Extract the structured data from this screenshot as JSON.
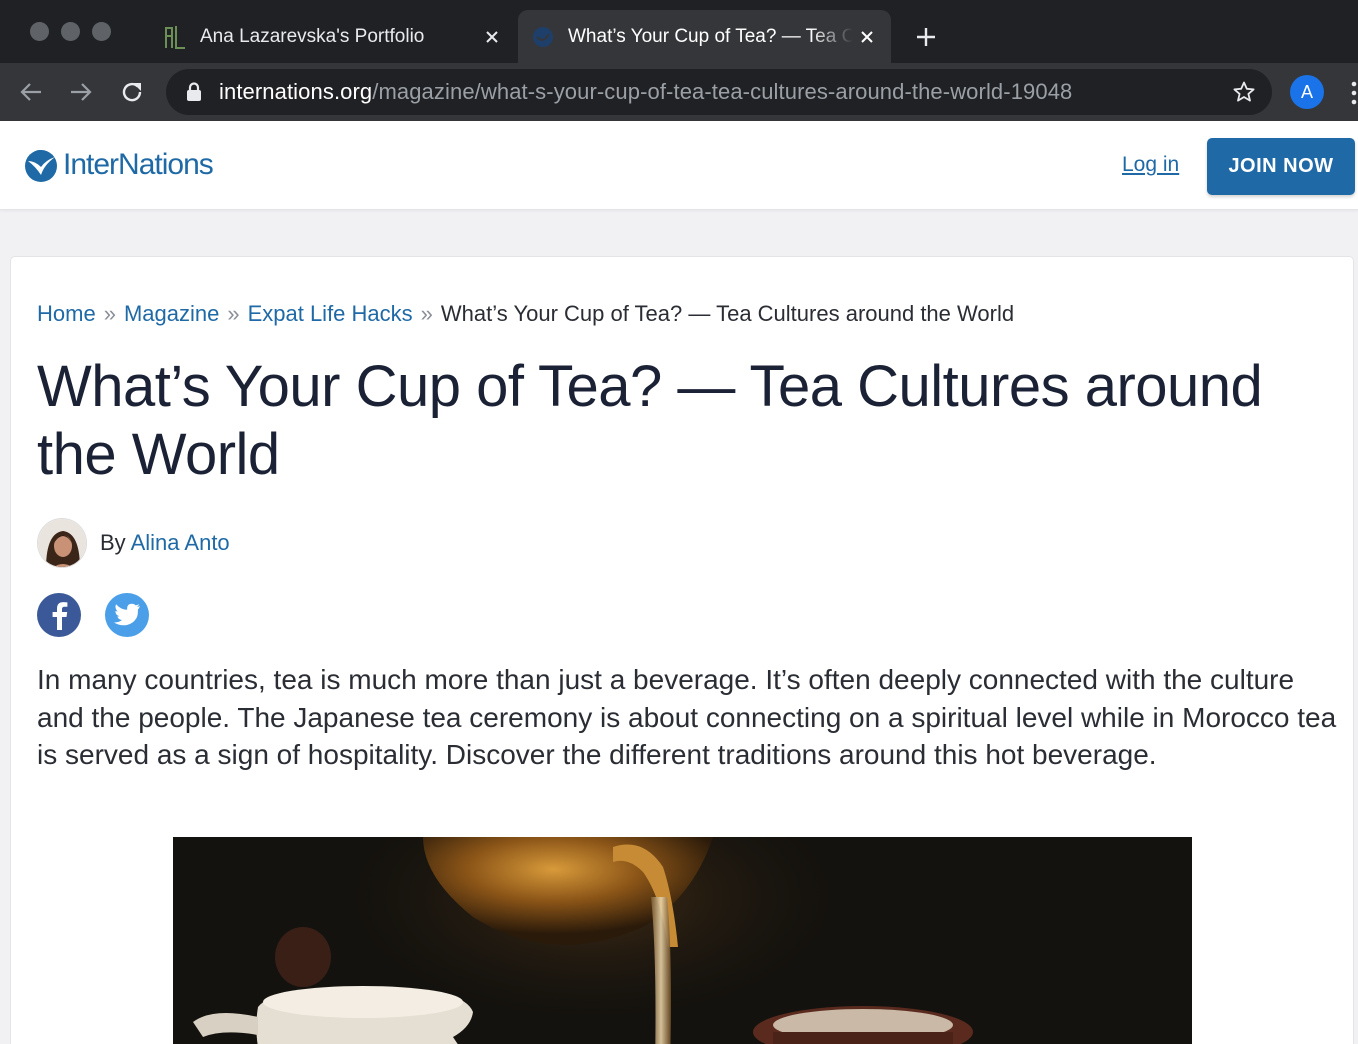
{
  "browser": {
    "tabs": [
      {
        "title": "Ana Lazarevska's Portfolio",
        "active": false
      },
      {
        "title": "What’s Your Cup of Tea? — Tea Cultures around the World",
        "active": true
      }
    ],
    "url_host": "internations.org",
    "url_path": "/magazine/what-s-your-cup-of-tea-tea-cultures-around-the-world-19048",
    "profile_initial": "A",
    "icons": [
      "back-arrow-icon",
      "forward-arrow-icon",
      "reload-icon",
      "lock-icon",
      "star-icon",
      "close-icon",
      "plus-icon",
      "kebab-menu-icon"
    ]
  },
  "site": {
    "logo_text": "InterNations",
    "login_label": "Log in",
    "join_label": "JOIN NOW",
    "brand_color": "#1f6aa6"
  },
  "article": {
    "breadcrumb": {
      "home": "Home",
      "magazine": "Magazine",
      "section": "Expat Life Hacks",
      "current": "What’s Your Cup of Tea? — Tea Cultures around the World",
      "separator": "»"
    },
    "title": "What’s Your Cup of Tea? — Tea Cultures around the World",
    "by_label": "By",
    "author": "Alina Anto",
    "share": [
      "facebook-icon",
      "twitter-icon"
    ],
    "intro": "In many countries, tea is much more than just a beverage. It’s often deeply connected with the culture and the people. The Japanese tea ceremony is about connecting on a spiritual level while in Morocco tea is served as a sign of hospitality. Discover the different traditions around this hot beverage."
  }
}
